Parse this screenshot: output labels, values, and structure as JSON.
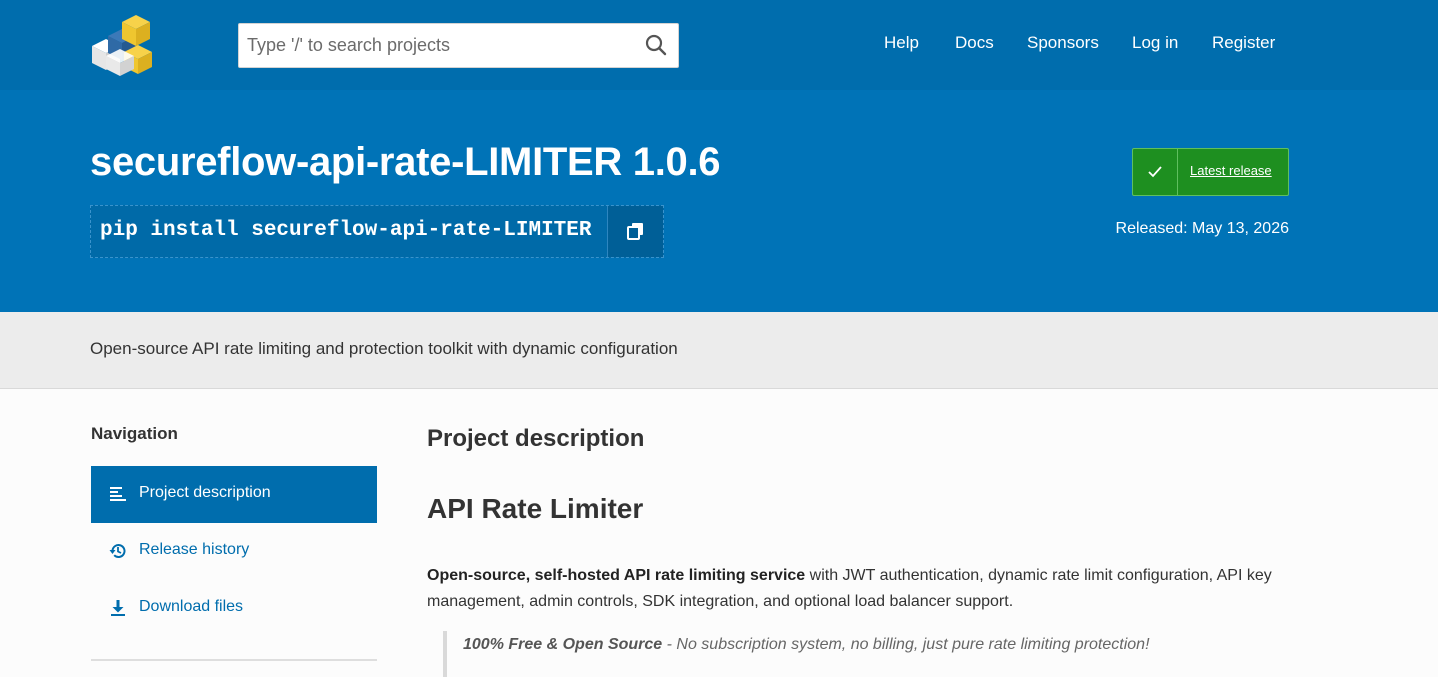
{
  "header": {
    "search_placeholder": "Type '/' to search projects",
    "nav": [
      "Help",
      "Docs",
      "Sponsors",
      "Log in",
      "Register"
    ]
  },
  "hero": {
    "title": "secureflow-api-rate-LIMITER 1.0.6",
    "pip_command": "pip install secureflow-api-rate-LIMITER",
    "latest_release_label": "Latest release",
    "released": "Released: May 13, 2026"
  },
  "summary": "Open-source API rate limiting and protection toolkit with dynamic configuration",
  "sidebar": {
    "heading": "Navigation",
    "items": [
      {
        "label": "Project description",
        "icon": "align-left-icon",
        "active": true
      },
      {
        "label": "Release history",
        "icon": "history-icon",
        "active": false
      },
      {
        "label": "Download files",
        "icon": "download-icon",
        "active": false
      }
    ]
  },
  "main": {
    "section_title": "Project description",
    "readme_title": "API Rate Limiter",
    "intro_bold": "Open-source, self-hosted API rate limiting service",
    "intro_rest": " with JWT authentication, dynamic rate limit configuration, API key management, admin controls, SDK integration, and optional load balancer support.",
    "quote_bold": "100% Free & Open Source",
    "quote_rest": " - No subscription system, no billing, just pure rate limiting protection!"
  },
  "colors": {
    "brand_blue": "#006dad",
    "hero_blue": "#0073b7",
    "release_green": "#1e8f20",
    "summary_gray": "#ececec"
  }
}
